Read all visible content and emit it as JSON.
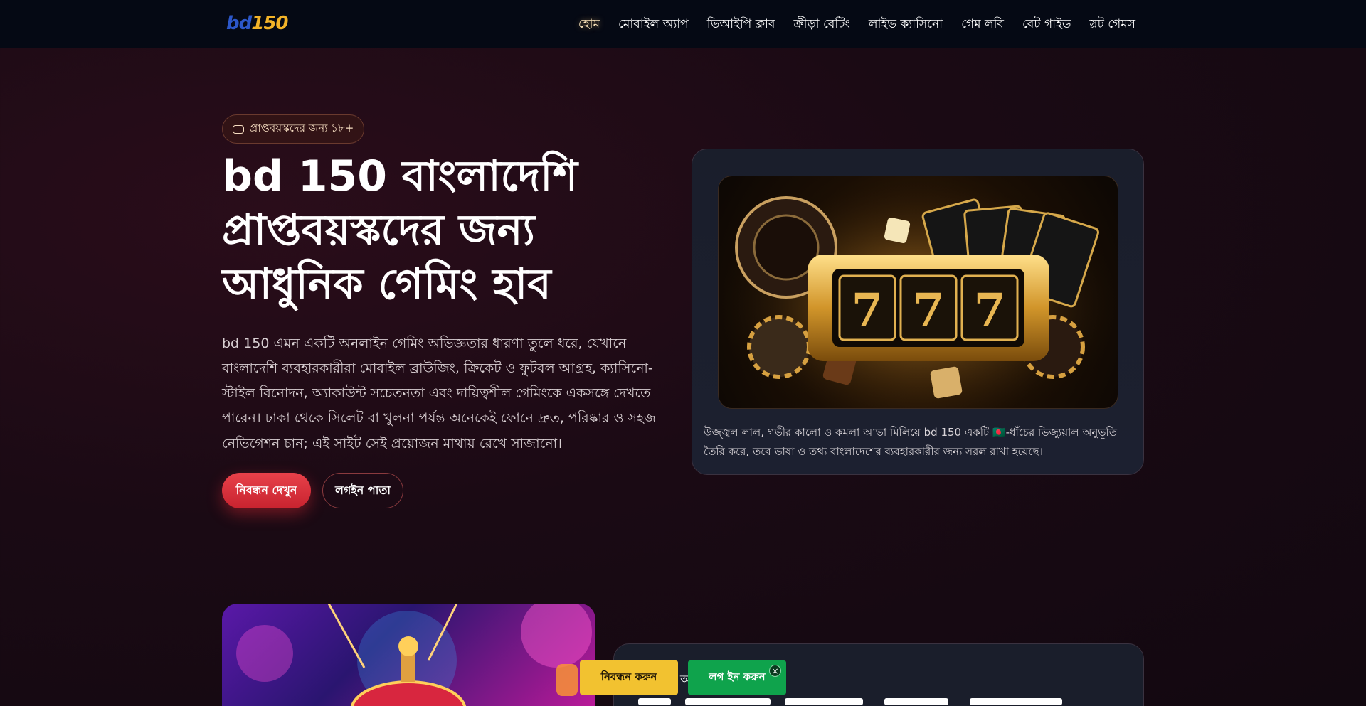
{
  "nav": {
    "logo_part1": "bd",
    "logo_part2": "150",
    "links": [
      "হোম",
      "মোবাইল অ্যাপ",
      "ভিআইপি ক্লাব",
      "ক্রীড়া বেটিং",
      "লাইভ ক্যাসিনো",
      "গেম লবি",
      "বেট গাইড",
      "স্লট গেমস"
    ]
  },
  "hero": {
    "badge": "প্রাপ্তবয়স্কদের জন্য ১৮+",
    "title": "bd 150 বাংলাদেশি প্রাপ্তবয়স্কদের জন্য আধুনিক গেমিং হাব",
    "description": "bd 150 এমন একটি অনলাইন গেমিং অভিজ্ঞতার ধারণা তুলে ধরে, যেখানে বাংলাদেশি ব্যবহারকারীরা মোবাইল ব্রাউজিং, ক্রিকেট ও ফুটবল আগ্রহ, ক্যাসিনো-স্টাইল বিনোদন, অ্যাকাউন্ট সচেতনতা এবং দায়িত্বশীল গেমিংকে একসঙ্গে দেখতে পারেন। ঢাকা থেকে সিলেট বা খুলনা পর্যন্ত অনেকেই ফোনে দ্রুত, পরিষ্কার ও সহজ নেভিগেশন চান; এই সাইট সেই প্রয়োজন মাথায় রেখে সাজানো।",
    "primary_button": "নিবন্ধন দেখুন",
    "secondary_button": "লগইন পাতা",
    "image_caption": "উজ্জ্বল লাল, গভীর কালো ও কমলা আভা মিলিয়ে bd 150 একটি 🇧🇩-ধাঁচের ভিজ্যুয়াল অনুভূতি তৈরি করে, তবে ভাষা ও তথ্য বাংলাদেশের ব্যবহারকারীর জন্য সরল রাখা হয়েছে।",
    "slot_digits": [
      "7",
      "7",
      "7"
    ]
  },
  "floating": {
    "register": "নিবন্ধন করুন",
    "login": "লগ ইন করুন",
    "close": "×",
    "peek_text": "আ"
  },
  "colors": {
    "accent_red": "#e8414a",
    "accent_gold": "#f2c230",
    "accent_green": "#0fa34c",
    "logo_blue": "#2c57c9",
    "logo_gold": "#f3b328"
  }
}
